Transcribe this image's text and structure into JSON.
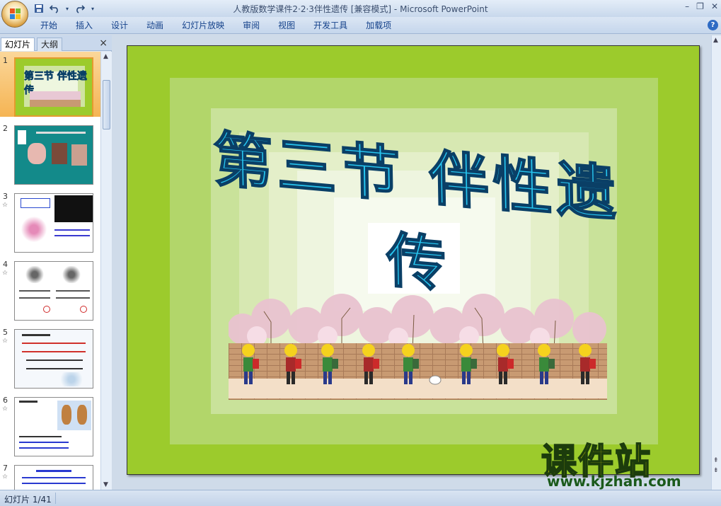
{
  "app": {
    "title": "人教版数学课件2·2·3伴性遗传 [兼容模式] - Microsoft PowerPoint"
  },
  "quick_access": {
    "save_icon": "save-icon",
    "undo_icon": "undo-icon",
    "redo_icon": "redo-icon",
    "customize_icon": "chevron-down-icon"
  },
  "ribbon": {
    "tabs": [
      "开始",
      "插入",
      "设计",
      "动画",
      "幻灯片放映",
      "审阅",
      "视图",
      "开发工具",
      "加载项"
    ]
  },
  "left_pane": {
    "tab_slides": "幻灯片",
    "tab_outline": "大纲",
    "close": "×",
    "slides": [
      {
        "num": "1",
        "star": ""
      },
      {
        "num": "2",
        "star": ""
      },
      {
        "num": "3",
        "star": "☆"
      },
      {
        "num": "4",
        "star": "☆"
      },
      {
        "num": "5",
        "star": "☆"
      },
      {
        "num": "6",
        "star": "☆"
      },
      {
        "num": "7",
        "star": "☆"
      }
    ]
  },
  "slide": {
    "title": "第三节  伴性遗传"
  },
  "watermark": {
    "title": "课件站",
    "url": "www.kjzhan.com"
  },
  "status": {
    "slide_info": "幻灯片 1/41"
  },
  "colors": {
    "slide_bg": "#9ccb2c",
    "title_fill": "#27c6f0",
    "title_stroke": "#0a3f66",
    "selected_thumb": "#f5b453"
  }
}
